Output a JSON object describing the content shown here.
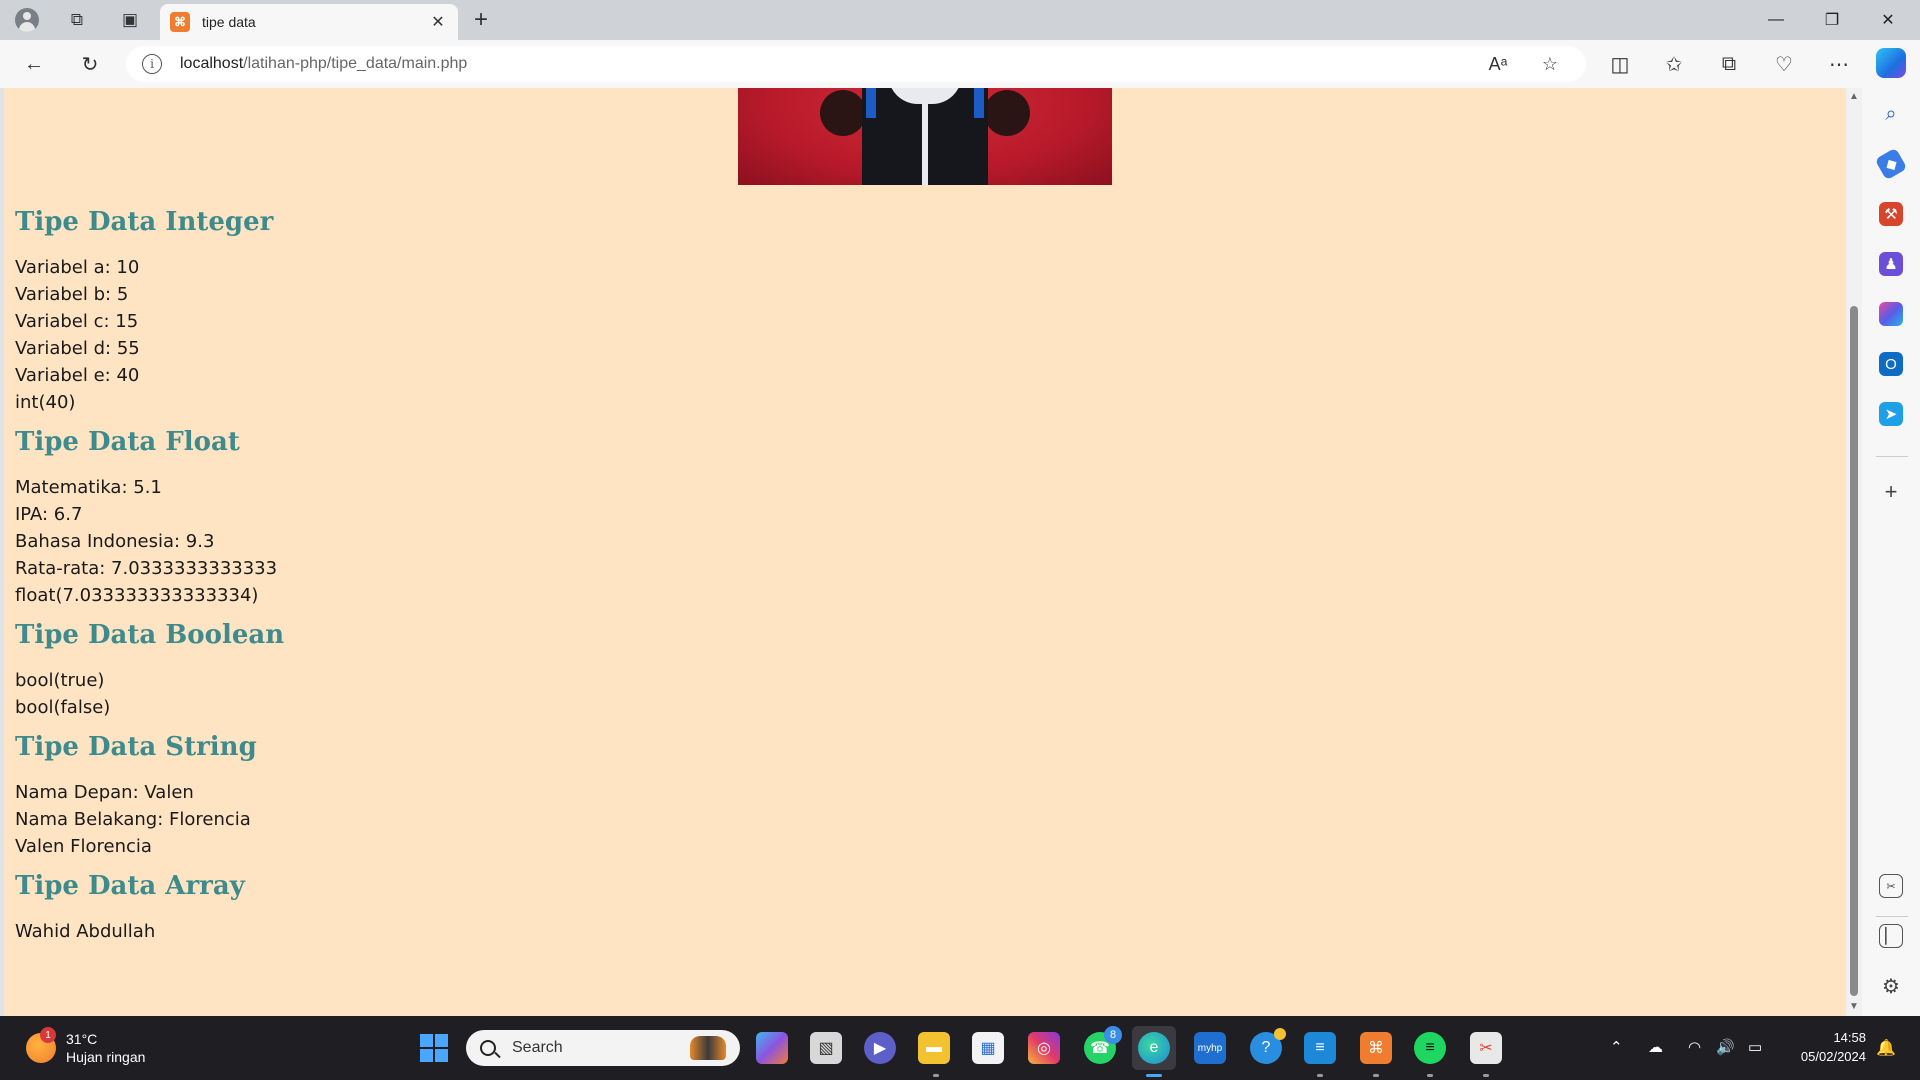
{
  "browser": {
    "tab_title": "tipe data",
    "tab_favicon": "xampp-icon",
    "address_host": "localhost",
    "address_path": "/latihan-php/tipe_data/main.php"
  },
  "sections": [
    {
      "heading": "Tipe Data Integer",
      "lines": [
        "Variabel a: 10",
        "Variabel b: 5",
        "Variabel c: 15",
        "Variabel d: 55",
        "Variabel e: 40",
        "int(40)"
      ]
    },
    {
      "heading": "Tipe Data Float",
      "lines": [
        "Matematika: 5.1",
        "IPA: 6.7",
        "Bahasa Indonesia: 9.3",
        "Rata-rata: 7.0333333333333",
        "float(7.033333333333334)"
      ]
    },
    {
      "heading": "Tipe Data Boolean",
      "lines": [
        "bool(true)",
        "bool(false)"
      ]
    },
    {
      "heading": "Tipe Data String",
      "lines": [
        "Nama Depan: Valen",
        "Nama Belakang: Florencia",
        "Valen Florencia"
      ]
    },
    {
      "heading": "Tipe Data Array",
      "lines": [
        "Wahid Abdullah"
      ]
    }
  ],
  "colors": {
    "page_background": "#ffe4c4",
    "heading": "#3e8a8c",
    "text": "#1a1a1a"
  },
  "taskbar": {
    "weather_temp": "31°C",
    "weather_desc": "Hujan ringan",
    "weather_badge": "1",
    "search_placeholder": "Search",
    "whatsapp_badge": "8",
    "time": "14:58",
    "date": "05/02/2024",
    "myhp_label": "myhp"
  }
}
